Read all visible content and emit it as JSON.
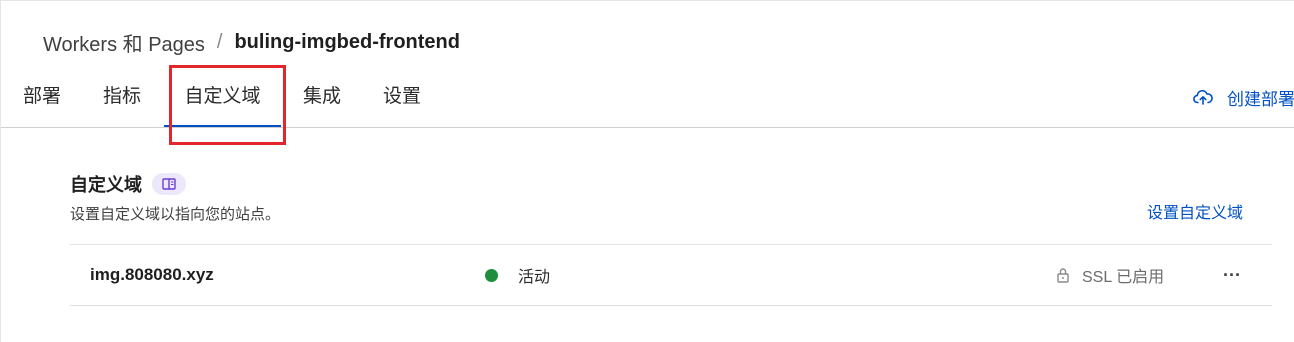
{
  "breadcrumb": {
    "parent": "Workers 和 Pages",
    "separator": "/",
    "current": "buling-imgbed-frontend"
  },
  "tabs": [
    {
      "label": "部署",
      "active": false
    },
    {
      "label": "指标",
      "active": false
    },
    {
      "label": "自定义域",
      "active": true
    },
    {
      "label": "集成",
      "active": false
    },
    {
      "label": "设置",
      "active": false
    }
  ],
  "header_actions": {
    "create_deploy_label": "创建部署",
    "create_deploy_icon": "cloud-upload-icon"
  },
  "section": {
    "title": "自定义域",
    "badge_icon": "book-icon",
    "description": "设置自定义域以指向您的站点。",
    "setup_link": "设置自定义域"
  },
  "domains": [
    {
      "name": "img.808080.xyz",
      "status": "活动",
      "status_color": "#1e8e3e",
      "ssl": "SSL 已启用",
      "ssl_icon": "lock-icon",
      "menu_icon": "more-horizontal-icon",
      "menu_glyph": "···"
    }
  ],
  "colors": {
    "accent": "#0051c3",
    "highlight": "#e3262b"
  }
}
